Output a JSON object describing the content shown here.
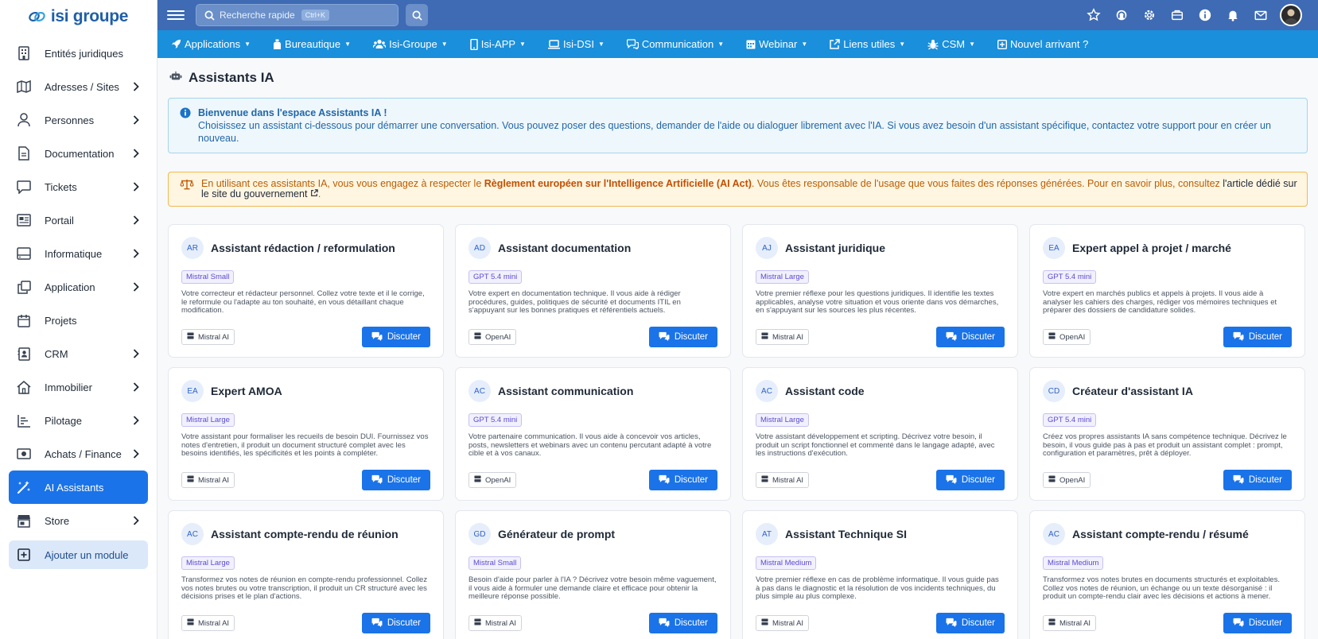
{
  "brand": {
    "name": "isi groupe"
  },
  "sidebar": {
    "items": [
      {
        "label": "Entités juridiques",
        "icon": "building-icon",
        "chevron": false
      },
      {
        "label": "Adresses / Sites",
        "icon": "map-icon",
        "chevron": true
      },
      {
        "label": "Personnes",
        "icon": "user-icon",
        "chevron": true
      },
      {
        "label": "Documentation",
        "icon": "file-icon",
        "chevron": true
      },
      {
        "label": "Tickets",
        "icon": "chat-icon",
        "chevron": true
      },
      {
        "label": "Portail",
        "icon": "newspaper-icon",
        "chevron": true
      },
      {
        "label": "Informatique",
        "icon": "server-icon",
        "chevron": true
      },
      {
        "label": "Application",
        "icon": "copy-icon",
        "chevron": true
      },
      {
        "label": "Projets",
        "icon": "calendar-icon",
        "chevron": false
      },
      {
        "label": "CRM",
        "icon": "contact-card-icon",
        "chevron": true
      },
      {
        "label": "Immobilier",
        "icon": "home-icon",
        "chevron": true
      },
      {
        "label": "Pilotage",
        "icon": "chart-icon",
        "chevron": true
      },
      {
        "label": "Achats / Finance",
        "icon": "money-icon",
        "chevron": true
      },
      {
        "label": "AI Assistants",
        "icon": "magic-wand-icon",
        "chevron": false,
        "active": true
      },
      {
        "label": "Store",
        "icon": "store-icon",
        "chevron": true
      }
    ],
    "add_module": "Ajouter un module"
  },
  "topbar": {
    "search_placeholder": "Recherche rapide",
    "search_shortcut": "Ctrl+K",
    "icons": [
      "star-icon",
      "support-icon",
      "gear-icon",
      "toolbox-icon",
      "info-icon",
      "bell-icon",
      "mail-icon"
    ]
  },
  "menu": [
    {
      "label": "Applications",
      "icon": "rocket-icon",
      "caret": true
    },
    {
      "label": "Bureautique",
      "icon": "bottle-icon",
      "caret": true
    },
    {
      "label": "Isi-Groupe",
      "icon": "users-icon",
      "caret": true
    },
    {
      "label": "Isi-APP",
      "icon": "mobile-icon",
      "caret": true
    },
    {
      "label": "Isi-DSI",
      "icon": "laptop-icon",
      "caret": true
    },
    {
      "label": "Communication",
      "icon": "chat-icon",
      "caret": true
    },
    {
      "label": "Webinar",
      "icon": "calendar-icon",
      "caret": true
    },
    {
      "label": "Liens utiles",
      "icon": "external-link-icon",
      "caret": true
    },
    {
      "label": "CSM",
      "icon": "bug-icon",
      "caret": true
    },
    {
      "label": "Nouvel arrivant ?",
      "icon": "plus-square-icon",
      "caret": false
    }
  ],
  "page": {
    "title": "Assistants IA",
    "info_title": "Bienvenue dans l'espace Assistants IA !",
    "info_text": "Choisissez un assistant ci-dessous pour démarrer une conversation. Vous pouvez poser des questions, demander de l'aide ou dialoguer librement avec l'IA. Si vous avez besoin d'un assistant spécifique, contactez votre support pour en créer un nouveau.",
    "warn_pre": "En utilisant ces assistants IA, vous vous engagez à respecter le ",
    "warn_bold": "Règlement européen sur l'Intelligence Artificielle (AI Act)",
    "warn_mid": ". Vous êtes responsable de l'usage que vous faites des réponses générées. Pour en savoir plus, consultez ",
    "warn_link": "l'article dédié sur le site du gouvernement",
    "warn_end": "."
  },
  "button_label": "Discuter",
  "cards": [
    {
      "initials": "AR",
      "title": "Assistant rédaction / reformulation",
      "model": "Mistral Small",
      "desc": "Votre correcteur et rédacteur personnel. Collez votre texte et il le corrige, le reformule ou l'adapte au ton souhaité, en vous détaillant chaque modification.",
      "provider": "Mistral AI"
    },
    {
      "initials": "AD",
      "title": "Assistant documentation",
      "model": "GPT 5.4 mini",
      "desc": "Votre expert en documentation technique. Il vous aide à rédiger procédures, guides, politiques de sécurité et documents ITIL en s'appuyant sur les bonnes pratiques et référentiels actuels.",
      "provider": "OpenAI"
    },
    {
      "initials": "AJ",
      "title": "Assistant juridique",
      "model": "Mistral Large",
      "desc": "Votre premier réflexe pour les questions juridiques. Il identifie les textes applicables, analyse votre situation et vous oriente dans vos démarches, en s'appuyant sur les sources les plus récentes.",
      "provider": "Mistral AI"
    },
    {
      "initials": "EA",
      "title": "Expert appel à projet / marché",
      "model": "GPT 5.4 mini",
      "desc": "Votre expert en marchés publics et appels à projets. Il vous aide à analyser les cahiers des charges, rédiger vos mémoires techniques et préparer des dossiers de candidature solides.",
      "provider": "OpenAI"
    },
    {
      "initials": "EA",
      "title": "Expert AMOA",
      "model": "Mistral Large",
      "desc": "Votre assistant pour formaliser les recueils de besoin DUI. Fournissez vos notes d'entretien, il produit un document structuré complet avec les besoins identifiés, les spécificités et les points à compléter.",
      "provider": "Mistral AI"
    },
    {
      "initials": "AC",
      "title": "Assistant communication",
      "model": "GPT 5.4 mini",
      "desc": "Votre partenaire communication. Il vous aide à concevoir vos articles, posts, newsletters et webinars avec un contenu percutant adapté à votre cible et à vos canaux.",
      "provider": "OpenAI"
    },
    {
      "initials": "AC",
      "title": "Assistant code",
      "model": "Mistral Large",
      "desc": "Votre assistant développement et scripting. Décrivez votre besoin, il produit un script fonctionnel et commenté dans le langage adapté, avec les instructions d'exécution.",
      "provider": "Mistral AI"
    },
    {
      "initials": "CD",
      "title": "Créateur d'assistant IA",
      "model": "GPT 5.4 mini",
      "desc": "Créez vos propres assistants IA sans compétence technique. Décrivez le besoin, il vous guide pas à pas et produit un assistant complet : prompt, configuration et paramètres, prêt à déployer.",
      "provider": "OpenAI"
    },
    {
      "initials": "AC",
      "title": "Assistant compte-rendu de réunion",
      "model": "Mistral Large",
      "desc": "Transformez vos notes de réunion en compte-rendu professionnel. Collez vos notes brutes ou votre transcription, il produit un CR structuré avec les décisions prises et le plan d'actions.",
      "provider": "Mistral AI"
    },
    {
      "initials": "GD",
      "title": "Générateur de prompt",
      "model": "Mistral Small",
      "desc": "Besoin d'aide pour parler à l'IA ? Décrivez votre besoin même vaguement, il vous aide à formuler une demande claire et efficace pour obtenir la meilleure réponse possible.",
      "provider": "Mistral AI"
    },
    {
      "initials": "AT",
      "title": "Assistant Technique SI",
      "model": "Mistral Medium",
      "desc": "Votre premier réflexe en cas de problème informatique. Il vous guide pas à pas dans le diagnostic et la résolution de vos incidents techniques, du plus simple au plus complexe.",
      "provider": "Mistral AI"
    },
    {
      "initials": "AC",
      "title": "Assistant compte-rendu / résumé",
      "model": "Mistral Medium",
      "desc": "Transformez vos notes brutes en documents structurés et exploitables. Collez vos notes de réunion, un échange ou un texte désorganisé : il produit un compte-rendu clair avec les décisions et actions à mener.",
      "provider": "Mistral AI"
    }
  ]
}
